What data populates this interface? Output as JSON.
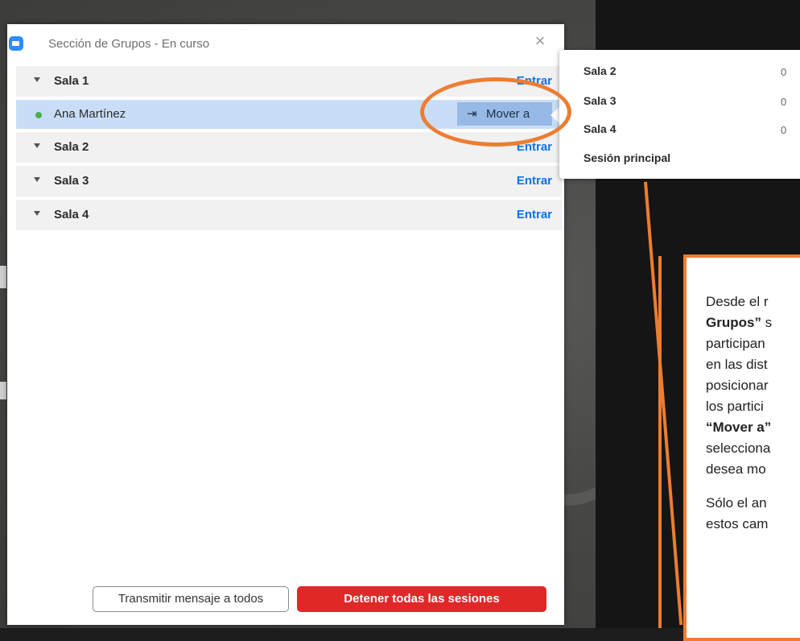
{
  "window": {
    "title": "Sección de Grupos - En curso",
    "close_symbol": "×"
  },
  "rooms": [
    {
      "name": "Sala 1",
      "enter_label": "Entrar",
      "participants": [
        {
          "name": "Ana Martínez",
          "status_color": "#4caf50"
        }
      ]
    },
    {
      "name": "Sala 2",
      "enter_label": "Entrar"
    },
    {
      "name": "Sala 3",
      "enter_label": "Entrar"
    },
    {
      "name": "Sala 4",
      "enter_label": "Entrar"
    }
  ],
  "move_button": {
    "label": "Mover a",
    "icon": "move-arrow-icon"
  },
  "move_menu": {
    "items": [
      {
        "label": "Sala 2",
        "count": "0"
      },
      {
        "label": "Sala 3",
        "count": "0"
      },
      {
        "label": "Sala 4",
        "count": "0"
      },
      {
        "label": "Sesión principal",
        "count": ""
      }
    ]
  },
  "footer": {
    "broadcast_label": "Transmitir mensaje a todos",
    "stop_label": "Detener todas las sesiones"
  },
  "callout": {
    "lines": [
      [
        "Desde el r",
        ""
      ],
      [
        "Grupos”",
        " s"
      ],
      [
        "participan",
        ""
      ],
      [
        "en las dist",
        ""
      ],
      [
        "posicionar",
        ""
      ],
      [
        "los partici",
        ""
      ],
      [
        "“Mover a”",
        ""
      ],
      [
        "selecciona",
        ""
      ],
      [
        "desea mo",
        ""
      ]
    ],
    "line2": "Sólo el an",
    "line3": "estos cam"
  },
  "colors": {
    "accent_blue": "#0e72ed",
    "stop_red": "#e02828",
    "annotation_orange": "#ed7d31",
    "selected_row": "#c9def6"
  }
}
